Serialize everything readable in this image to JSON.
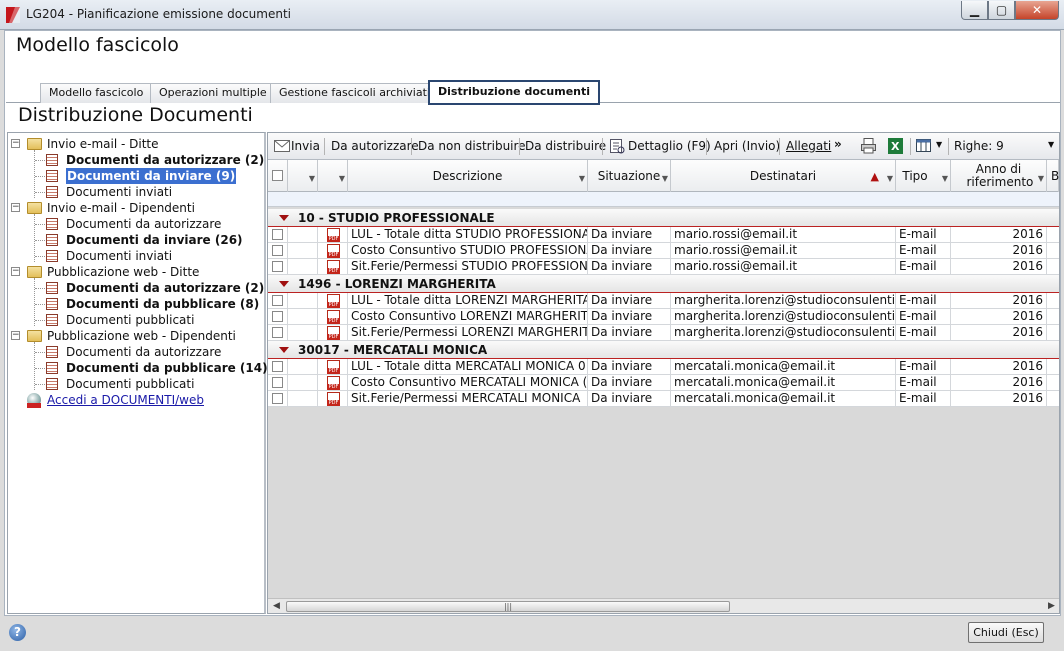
{
  "window": {
    "title": "LG204 - Pianificazione emissione documenti",
    "min": "▁",
    "max": "▢",
    "close": "✕"
  },
  "header": {
    "title": "Modello fascicolo"
  },
  "tabs": [
    "Modello fascicolo",
    "Operazioni multiple",
    "Gestione fascicoli archiviati",
    "Distribuzione documenti"
  ],
  "section": {
    "title": "Distribuzione Documenti"
  },
  "tree": [
    {
      "label": "Invio e-mail - Ditte",
      "type": "folder"
    },
    {
      "label": "Documenti da autorizzare (2)",
      "type": "doc",
      "bold": true
    },
    {
      "label": "Documenti da inviare (9)",
      "type": "doc",
      "bold": true,
      "selected": true
    },
    {
      "label": "Documenti inviati",
      "type": "doc"
    },
    {
      "label": "Invio e-mail - Dipendenti",
      "type": "folder"
    },
    {
      "label": "Documenti da autorizzare",
      "type": "doc"
    },
    {
      "label": "Documenti da inviare (26)",
      "type": "doc",
      "bold": true
    },
    {
      "label": "Documenti inviati",
      "type": "doc"
    },
    {
      "label": "Pubblicazione web - Ditte",
      "type": "folder"
    },
    {
      "label": "Documenti da autorizzare (2)",
      "type": "doc",
      "bold": true
    },
    {
      "label": "Documenti da pubblicare (8)",
      "type": "doc",
      "bold": true
    },
    {
      "label": "Documenti pubblicati",
      "type": "doc"
    },
    {
      "label": "Pubblicazione web - Dipendenti",
      "type": "folder"
    },
    {
      "label": "Documenti da autorizzare",
      "type": "doc"
    },
    {
      "label": "Documenti da pubblicare (14)",
      "type": "doc",
      "bold": true
    },
    {
      "label": "Documenti pubblicati",
      "type": "doc"
    },
    {
      "label": "Accedi a DOCUMENTI/web",
      "type": "link"
    }
  ],
  "toolbar": {
    "invia": "Invia",
    "da_autorizzare": "Da autorizzare",
    "da_non_distribuire": "Da non distribuire",
    "da_distribuire": "Da distribuire",
    "dettaglio": "Dettaglio (F9)",
    "apri": "Apri (Invio)",
    "allegati": "Allegati",
    "more": "»",
    "righe": "Righe: 9"
  },
  "columns": {
    "descrizione": "Descrizione",
    "situazione": "Situazione",
    "destinatari": "Destinatari",
    "tipo": "Tipo",
    "anno": "Anno di riferimento",
    "extra": "B"
  },
  "groups": [
    {
      "label": "10 - STUDIO PROFESSIONALE",
      "rows": [
        {
          "descrizione": "LUL - Totale ditta STUDIO PROFESSIONALE",
          "situazione": "Da inviare",
          "destinatari": "mario.rossi@email.it",
          "tipo": "E-mail",
          "anno": "2016"
        },
        {
          "descrizione": "Costo Consuntivo STUDIO PROFESSIONALE",
          "situazione": "Da inviare",
          "destinatari": "mario.rossi@email.it",
          "tipo": "E-mail",
          "anno": "2016"
        },
        {
          "descrizione": "Sit.Ferie/Permessi STUDIO PROFESSIONALE",
          "situazione": "Da inviare",
          "destinatari": "mario.rossi@email.it",
          "tipo": "E-mail",
          "anno": "2016"
        }
      ]
    },
    {
      "label": "1496 - LORENZI MARGHERITA",
      "rows": [
        {
          "descrizione": "LUL - Totale ditta LORENZI MARGHERITA",
          "situazione": "Da inviare",
          "destinatari": "margherita.lorenzi@studioconsulenti.it",
          "tipo": "E-mail",
          "anno": "2016"
        },
        {
          "descrizione": "Costo Consuntivo LORENZI MARGHERITA",
          "situazione": "Da inviare",
          "destinatari": "margherita.lorenzi@studioconsulenti.it",
          "tipo": "E-mail",
          "anno": "2016"
        },
        {
          "descrizione": "Sit.Ferie/Permessi LORENZI MARGHERITA",
          "situazione": "Da inviare",
          "destinatari": "margherita.lorenzi@studioconsulenti.it",
          "tipo": "E-mail",
          "anno": "2016"
        }
      ]
    },
    {
      "label": "30017 - MERCATALI MONICA",
      "rows": [
        {
          "descrizione": "LUL - Totale ditta MERCATALI MONICA 0",
          "situazione": "Da inviare",
          "destinatari": "mercatali.monica@email.it",
          "tipo": "E-mail",
          "anno": "2016"
        },
        {
          "descrizione": "Costo Consuntivo MERCATALI MONICA (",
          "situazione": "Da inviare",
          "destinatari": "mercatali.monica@email.it",
          "tipo": "E-mail",
          "anno": "2016"
        },
        {
          "descrizione": "Sit.Ferie/Permessi MERCATALI MONICA",
          "situazione": "Da inviare",
          "destinatari": "mercatali.monica@email.it",
          "tipo": "E-mail",
          "anno": "2016"
        }
      ]
    }
  ],
  "footer": {
    "help": "?",
    "close_button": "Chiudi (Esc)"
  },
  "colors": {
    "selection": "#3b6fd0",
    "group_border": "#b22222",
    "active_tab_border": "#2a4670"
  }
}
